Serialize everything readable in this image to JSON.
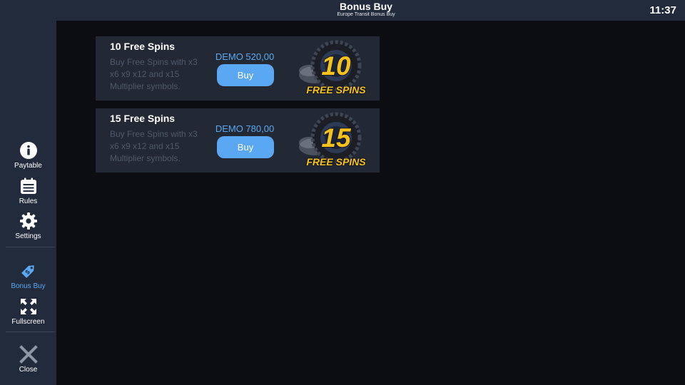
{
  "header": {
    "title": "Bonus Buy",
    "subtitle": "Europe Transit Bonus Buy",
    "clock": "11:37"
  },
  "sidebar": {
    "items": [
      {
        "label": "Paytable",
        "icon": "info-icon"
      },
      {
        "label": "Rules",
        "icon": "calendar-icon"
      },
      {
        "label": "Settings",
        "icon": "gear-icon"
      },
      {
        "label": "Bonus Buy",
        "icon": "price-tag-icon",
        "active": true
      },
      {
        "label": "Fullscreen",
        "icon": "fullscreen-icon"
      },
      {
        "label": "Close",
        "icon": "close-icon"
      }
    ]
  },
  "offers": [
    {
      "title": "10 Free Spins",
      "description": "Buy Free Spins with x3 x6 x9 x12 and x15 Multiplier symbols.",
      "price": "DEMO 520,00",
      "button": "Buy",
      "badge_number": "10",
      "badge_text": "FREE SPINS"
    },
    {
      "title": "15 Free Spins",
      "description": "Buy Free Spins with x3 x6 x9 x12 and x15 Multiplier symbols.",
      "price": "DEMO 780,00",
      "button": "Buy",
      "badge_number": "15",
      "badge_text": "FREE SPINS"
    }
  ],
  "colors": {
    "accent": "#5aa8f3",
    "sidebar_bg": "#222b3b",
    "page_bg": "#0b0d12",
    "card_bg": "#222935",
    "badge_gold": "#f5c21b"
  }
}
